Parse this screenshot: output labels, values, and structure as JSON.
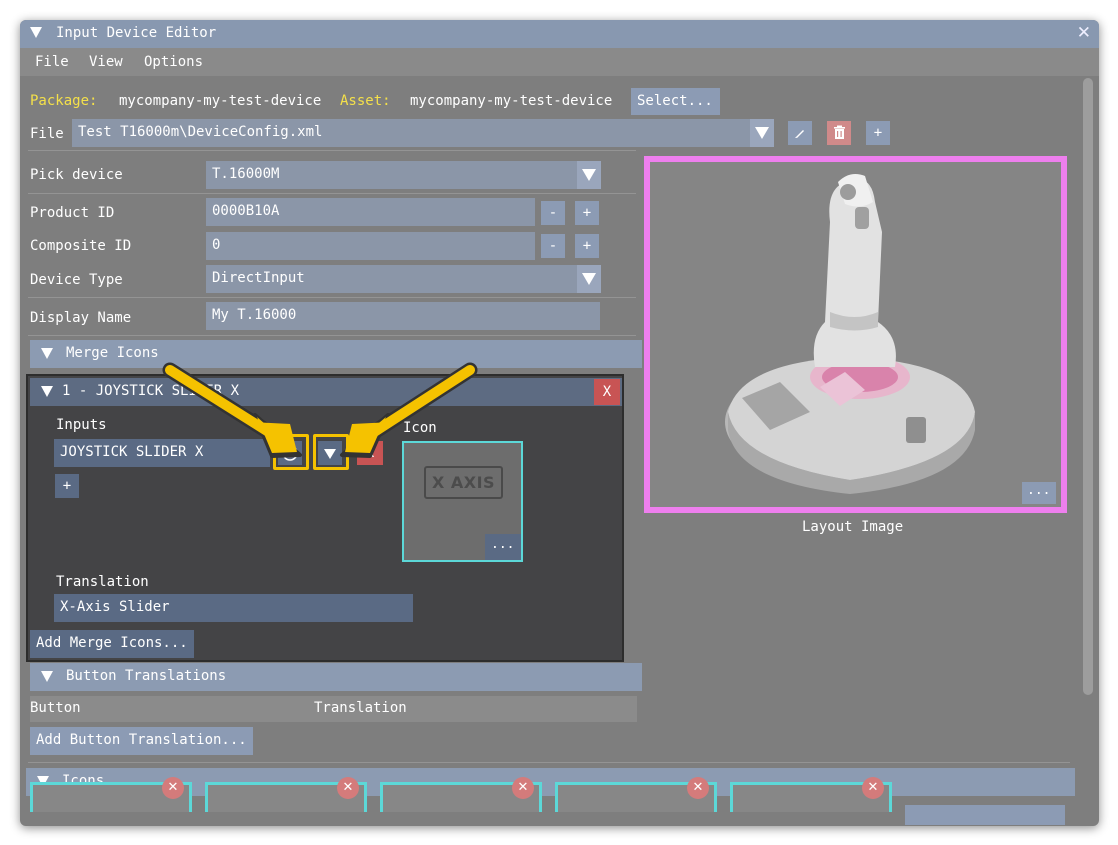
{
  "window": {
    "title": "Input Device Editor"
  },
  "menu": [
    "File",
    "View",
    "Options"
  ],
  "package": {
    "package_label": "Package:",
    "package_value": "mycompany-my-test-device",
    "asset_label": "Asset:",
    "asset_value": "mycompany-my-test-device",
    "select_label": "Select..."
  },
  "file": {
    "label": "File",
    "value": "Test T16000m\\DeviceConfig.xml",
    "edit_icon": "pencil-icon",
    "delete_icon": "trash-icon",
    "add_label": "+"
  },
  "form": {
    "pick_device": {
      "label": "Pick device",
      "value": "T.16000M"
    },
    "product_id": {
      "label": "Product ID",
      "value": "0000B10A"
    },
    "composite_id": {
      "label": "Composite ID",
      "value": "0"
    },
    "device_type": {
      "label": "Device Type",
      "value": "DirectInput"
    },
    "display_name": {
      "label": "Display Name",
      "value": "My T.16000"
    },
    "minus_label": "-",
    "plus_label": "+"
  },
  "merge_icons": {
    "header": "Merge Icons",
    "entry": {
      "title": "1 - JOYSTICK SLIDER X",
      "close_label": "X",
      "inputs_label": "Inputs",
      "input_value": "JOYSTICK SLIDER X",
      "remove_label": "X",
      "add_label": "+",
      "icon_label": "Icon",
      "icon_text": "X AXIS",
      "icon_more": "...",
      "translation_label": "Translation",
      "translation_value": "X-Axis Slider"
    },
    "add_label": "Add Merge Icons..."
  },
  "layout_image": {
    "caption": "Layout Image",
    "more": "..."
  },
  "button_translations": {
    "header": "Button Translations",
    "col_button": "Button",
    "col_translation": "Translation",
    "add_label": "Add Button Translation..."
  },
  "icons": {
    "header": "Icons"
  },
  "colors": {
    "accent": "#8c9bb4",
    "highlight": "#f5c200",
    "image_border": "#ee7fee",
    "icon_border": "#5cd8d8",
    "delete": "#d08a8a"
  }
}
